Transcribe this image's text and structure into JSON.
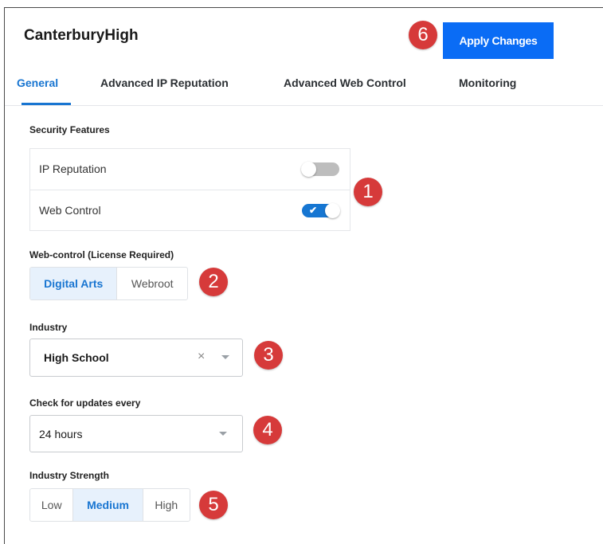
{
  "app": {
    "title": "CanterburyHigh",
    "apply_label": "Apply Changes"
  },
  "tabs": [
    {
      "label": "General",
      "active": true
    },
    {
      "label": "Advanced IP Reputation",
      "active": false
    },
    {
      "label": "Advanced Web Control",
      "active": false
    },
    {
      "label": "Monitoring",
      "active": false
    }
  ],
  "security": {
    "heading": "Security Features",
    "features": [
      {
        "label": "IP Reputation",
        "enabled": false
      },
      {
        "label": "Web Control",
        "enabled": true
      }
    ]
  },
  "webcontrol": {
    "heading": "Web-control (License Required)",
    "options": [
      "Digital Arts",
      "Webroot"
    ],
    "selected": "Digital Arts"
  },
  "industry": {
    "heading": "Industry",
    "value": "High School",
    "clear_icon": "×"
  },
  "updates": {
    "heading": "Check for updates every",
    "value": "24 hours"
  },
  "strength": {
    "heading": "Industry Strength",
    "options": [
      "Low",
      "Medium",
      "High"
    ],
    "selected": "Medium"
  },
  "callouts": [
    "1",
    "2",
    "3",
    "4",
    "5",
    "6"
  ],
  "colors": {
    "accent": "#1875d1",
    "button": "#0a6cf5",
    "callout": "#d63a3a",
    "toggle_off": "#bdbdbd"
  },
  "icons": {
    "check": "✔",
    "toggle_on": "toggle-on-icon",
    "toggle_off": "toggle-off-icon",
    "dropdown": "chevron-down-icon",
    "clear": "clear-icon"
  }
}
